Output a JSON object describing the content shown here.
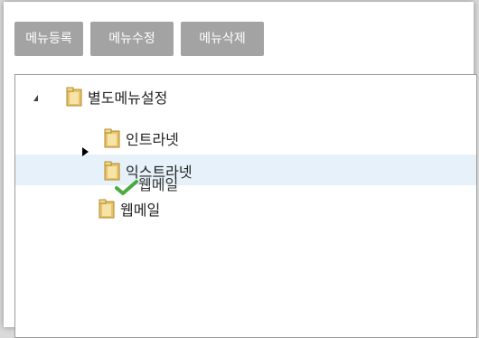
{
  "toolbar": {
    "register_label": "메뉴등록",
    "edit_label": "메뉴수정",
    "delete_label": "메뉴삭제"
  },
  "tree": {
    "root": {
      "label": "별도메뉴설정",
      "expanded": true
    },
    "children": [
      {
        "label": "인트라넷"
      },
      {
        "label": "익스트라넷"
      },
      {
        "label": "웹메일"
      }
    ],
    "drag_ghost_label": "웹메일"
  },
  "colors": {
    "button_bg": "#a3a3a3",
    "button_text": "#ffffff",
    "hover_row": "#e6f1f9",
    "folder": "#e8c36a",
    "check": "#3aa12b"
  },
  "icons": {
    "folder": "folder-icon",
    "expand": "triangle-expanded-icon",
    "collapse": "triangle-collapsed-icon",
    "check": "checkmark-icon"
  }
}
